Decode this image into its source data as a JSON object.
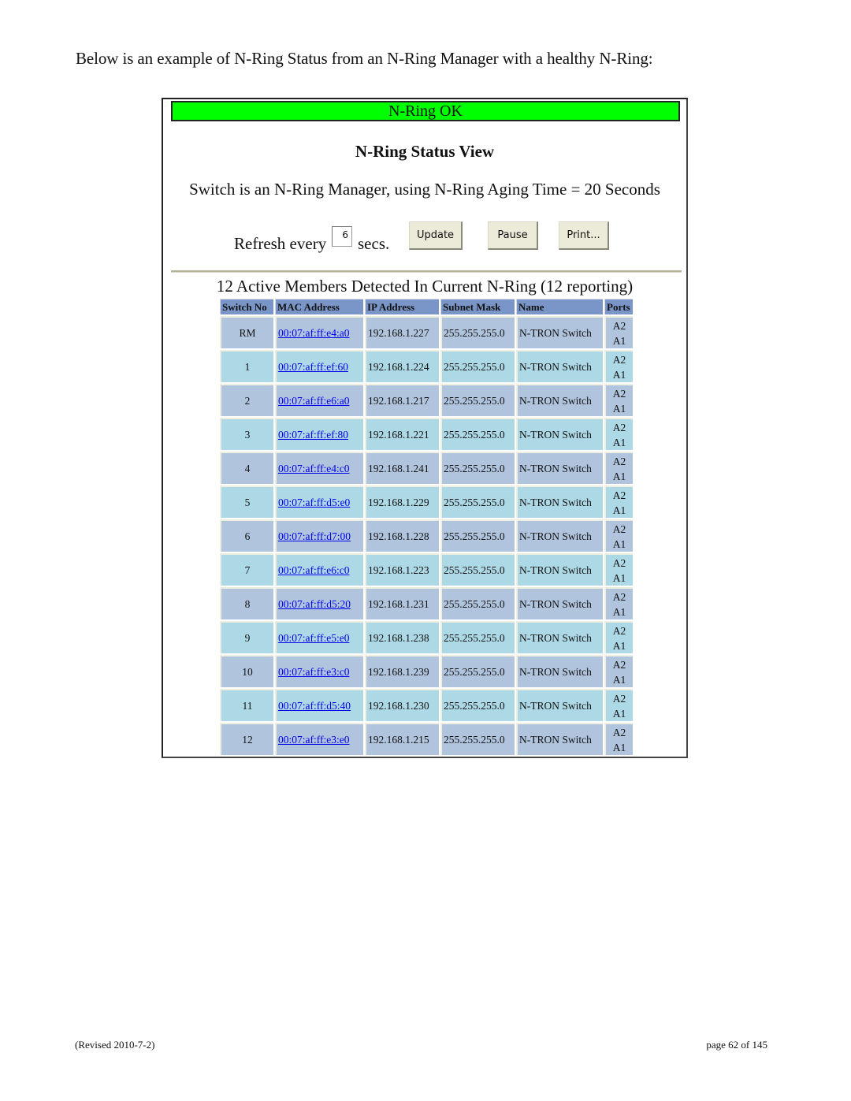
{
  "document": {
    "intro": "Below is an example of N-Ring Status from an N-Ring Manager with a healthy N-Ring:",
    "footer_left": "(Revised 2010-7-2)",
    "footer_right": "page 62 of 145"
  },
  "status_page": {
    "status_banner": "N-Ring OK",
    "status_color": "#00ff00",
    "title": "N-Ring Status View",
    "manager_line": "Switch is an N-Ring Manager, using N-Ring Aging Time = 20 Seconds",
    "refresh": {
      "label_before": "Refresh every",
      "value": "6",
      "label_after": "secs."
    },
    "buttons": {
      "update": "Update",
      "pause": "Pause",
      "print": "Print..."
    },
    "members_summary": "12 Active Members Detected In Current N-Ring (12 reporting)"
  },
  "table": {
    "columns": [
      "Switch No",
      "MAC Address",
      "IP Address",
      "Subnet Mask",
      "Name",
      "Ports"
    ],
    "rows": [
      {
        "switch_no": "RM",
        "mac": "00:07:af:ff:e4:a0",
        "ip": "192.168.1.227",
        "mask": "255.255.255.0",
        "name": "N-TRON Switch",
        "port_a": "A2",
        "port_b": "A1"
      },
      {
        "switch_no": "1",
        "mac": "00:07:af:ff:ef:60",
        "ip": "192.168.1.224",
        "mask": "255.255.255.0",
        "name": "N-TRON Switch",
        "port_a": "A2",
        "port_b": "A1"
      },
      {
        "switch_no": "2",
        "mac": "00:07:af:ff:e6:a0",
        "ip": "192.168.1.217",
        "mask": "255.255.255.0",
        "name": "N-TRON Switch",
        "port_a": "A2",
        "port_b": "A1"
      },
      {
        "switch_no": "3",
        "mac": "00:07:af:ff:ef:80",
        "ip": "192.168.1.221",
        "mask": "255.255.255.0",
        "name": "N-TRON Switch",
        "port_a": "A2",
        "port_b": "A1"
      },
      {
        "switch_no": "4",
        "mac": "00:07:af:ff:e4:c0",
        "ip": "192.168.1.241",
        "mask": "255.255.255.0",
        "name": "N-TRON Switch",
        "port_a": "A2",
        "port_b": "A1"
      },
      {
        "switch_no": "5",
        "mac": "00:07:af:ff:d5:e0",
        "ip": "192.168.1.229",
        "mask": "255.255.255.0",
        "name": "N-TRON Switch",
        "port_a": "A2",
        "port_b": "A1"
      },
      {
        "switch_no": "6",
        "mac": "00:07:af:ff:d7:00",
        "ip": "192.168.1.228",
        "mask": "255.255.255.0",
        "name": "N-TRON Switch",
        "port_a": "A2",
        "port_b": "A1"
      },
      {
        "switch_no": "7",
        "mac": "00:07:af:ff:e6:c0",
        "ip": "192.168.1.223",
        "mask": "255.255.255.0",
        "name": "N-TRON Switch",
        "port_a": "A2",
        "port_b": "A1"
      },
      {
        "switch_no": "8",
        "mac": "00:07:af:ff:d5:20",
        "ip": "192.168.1.231",
        "mask": "255.255.255.0",
        "name": "N-TRON Switch",
        "port_a": "A2",
        "port_b": "A1"
      },
      {
        "switch_no": "9",
        "mac": "00:07:af:ff:e5:e0",
        "ip": "192.168.1.238",
        "mask": "255.255.255.0",
        "name": "N-TRON Switch",
        "port_a": "A2",
        "port_b": "A1"
      },
      {
        "switch_no": "10",
        "mac": "00:07:af:ff:e3:c0",
        "ip": "192.168.1.239",
        "mask": "255.255.255.0",
        "name": "N-TRON Switch",
        "port_a": "A2",
        "port_b": "A1"
      },
      {
        "switch_no": "11",
        "mac": "00:07:af:ff:d5:40",
        "ip": "192.168.1.230",
        "mask": "255.255.255.0",
        "name": "N-TRON Switch",
        "port_a": "A2",
        "port_b": "A1"
      },
      {
        "switch_no": "12",
        "mac": "00:07:af:ff:e3:e0",
        "ip": "192.168.1.215",
        "mask": "255.255.255.0",
        "name": "N-TRON Switch",
        "port_a": "A2",
        "port_b": "A1"
      }
    ]
  }
}
